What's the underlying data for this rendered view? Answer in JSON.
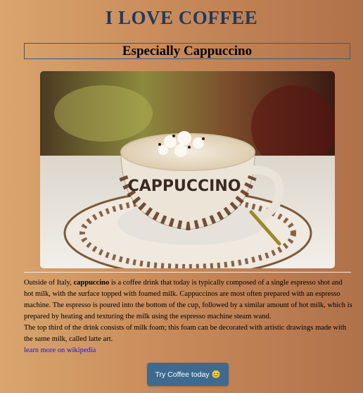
{
  "header": {
    "title": "I LOVE COFFEE",
    "subtitle": "Especially Cappuccino"
  },
  "image": {
    "cup_text": "CAPPUCCINO"
  },
  "article": {
    "p1_before": "Outside of Italy, ",
    "p1_bold": "cappuccino",
    "p1_after": " is a coffee drink that today is typically composed of a single espresso shot and hot milk, with the surface topped with foamed milk. Cappuccinos are most often prepared with an espresso machine. The espresso is poured into the bottom of the cup, followed by a similar amount of hot milk, which is prepared by heating and texturing the milk using the espresso machine steam wand.",
    "p2": "The top third of the drink consists of milk foam; this foam can be decorated with artistic drawings made with the same milk, called latte art.",
    "link_text": "learn more on wikipedia"
  },
  "cta": {
    "label": "Try Coffee today 😊"
  },
  "colors": {
    "title": "#1d3b63",
    "button": "#3f6a8f",
    "link": "#1a14d6"
  }
}
